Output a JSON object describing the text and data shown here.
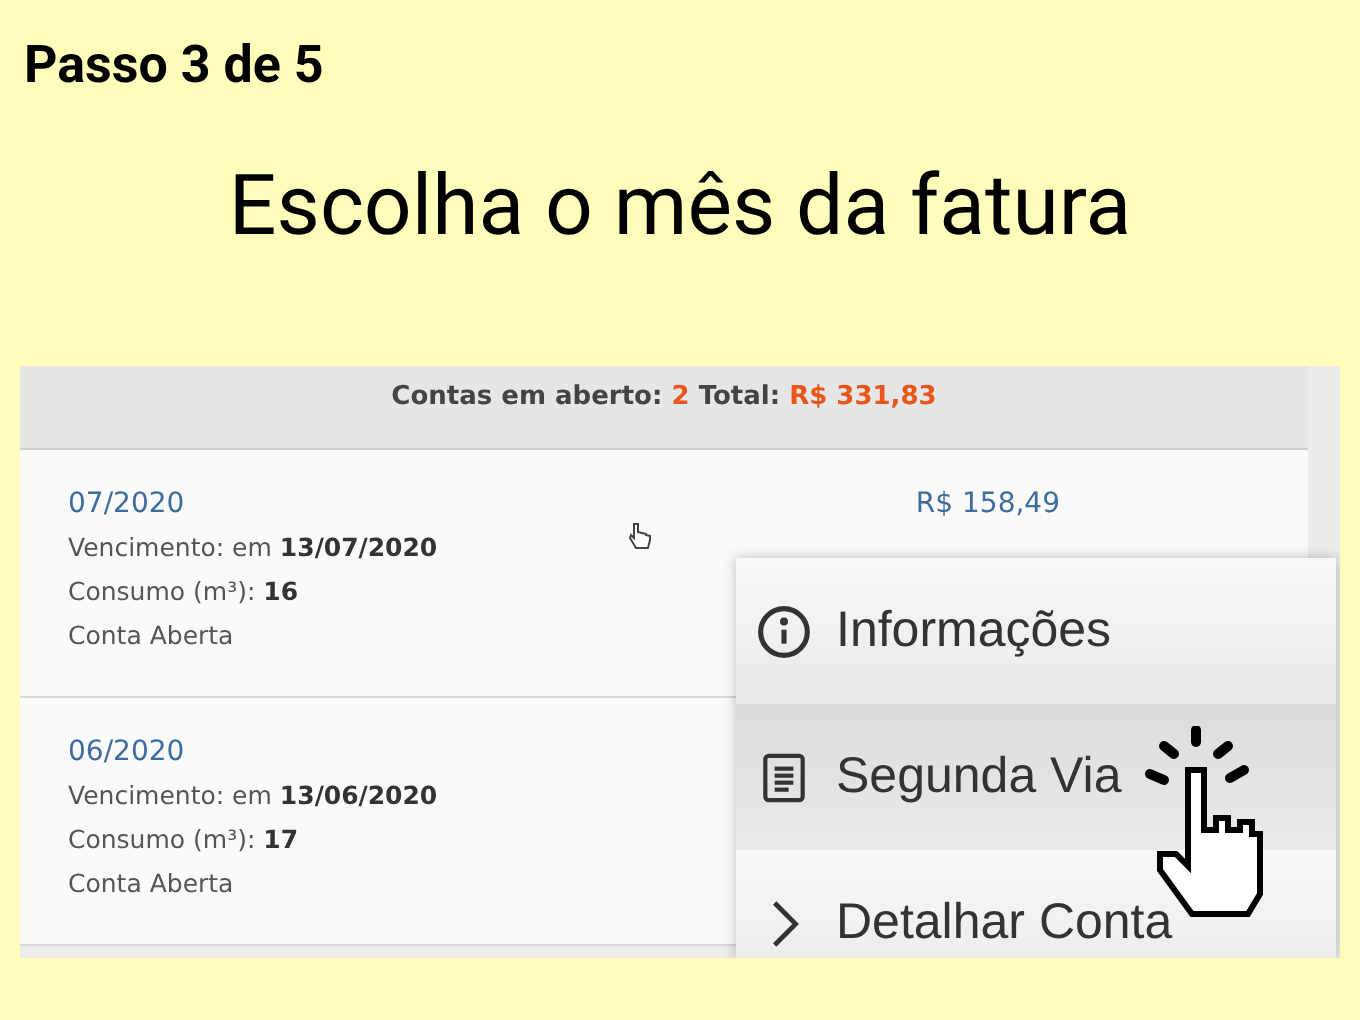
{
  "step": "Passo 3 de 5",
  "heading": "Escolha o mês da fatura",
  "summary": {
    "label": "Contas em aberto:",
    "count": "2",
    "total_label": "Total:",
    "total": "R$ 331,83"
  },
  "bills": [
    {
      "month": "07/2020",
      "amount": "R$ 158,49",
      "due_label": "Vencimento: em",
      "due": "13/07/2020",
      "usage_label": "Consumo (m³):",
      "usage": "16",
      "status": "Conta Aberta"
    },
    {
      "month": "06/2020",
      "due_label": "Vencimento: em",
      "due": "13/06/2020",
      "usage_label": "Consumo (m³):",
      "usage": "17",
      "status": "Conta Aberta"
    }
  ],
  "menu": [
    {
      "kind": "info",
      "label": "Informações",
      "selected": false
    },
    {
      "kind": "document",
      "label": "Segunda Via",
      "selected": true
    },
    {
      "kind": "chevron",
      "label": "Detalhar Conta",
      "selected": false
    }
  ]
}
